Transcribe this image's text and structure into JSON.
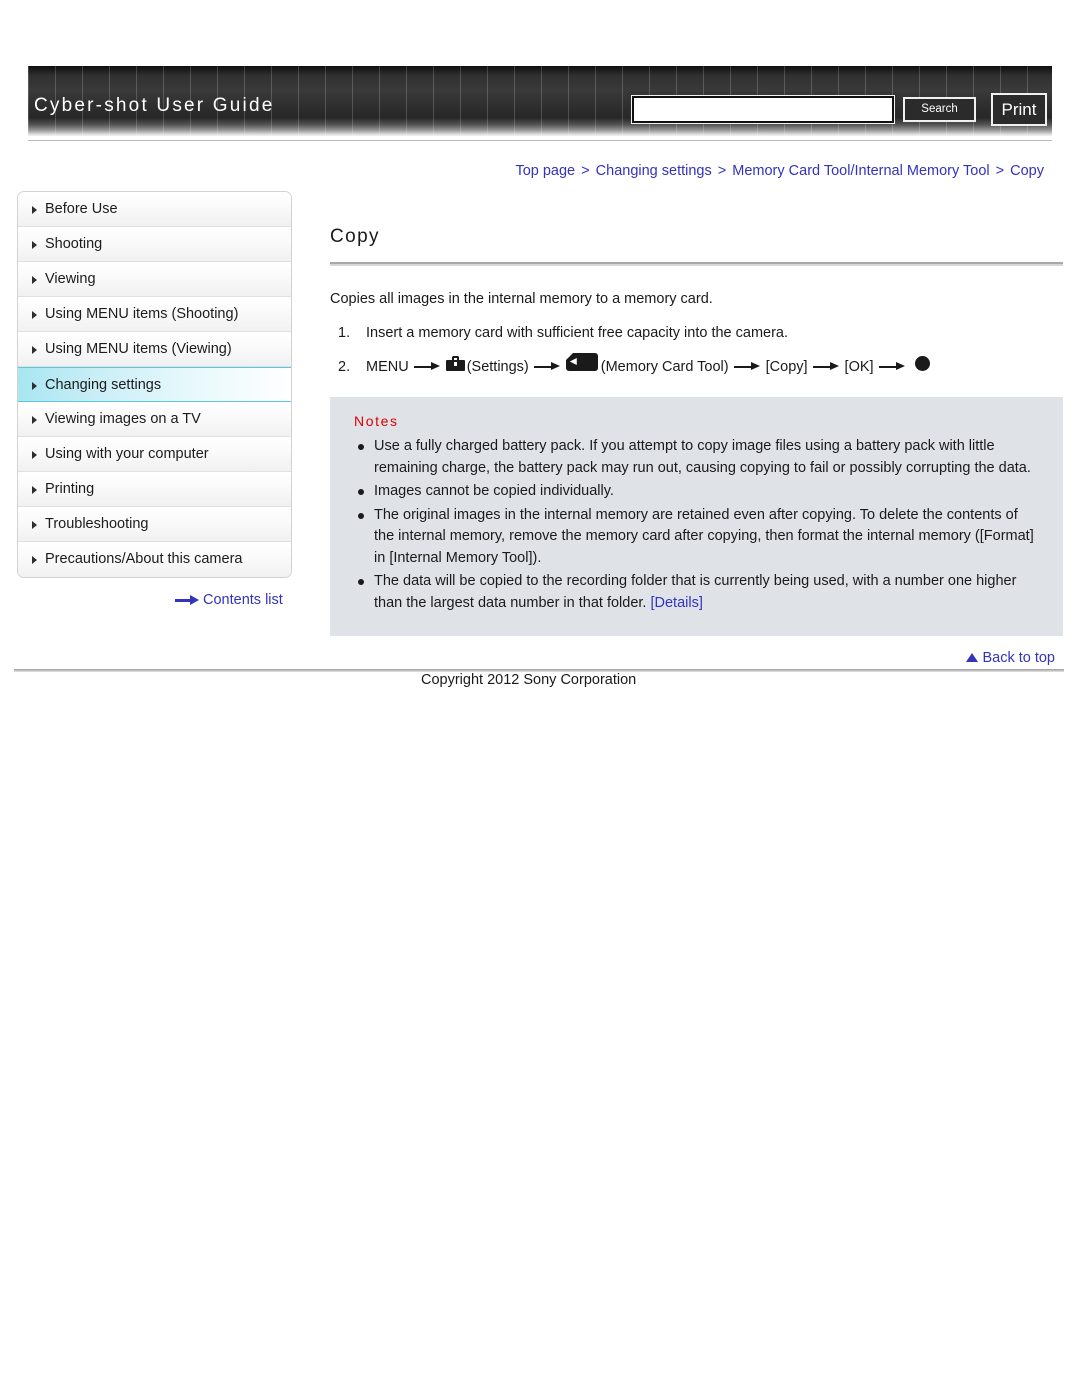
{
  "header": {
    "site_title": "Cyber-shot User Guide",
    "search_value": "",
    "search_placeholder": "",
    "search_button_label": "Search",
    "print_button_label": "Print"
  },
  "breadcrumb": {
    "items": [
      "Top page",
      "Changing settings",
      "Memory Card Tool/Internal Memory Tool",
      "Copy"
    ],
    "separator": ">"
  },
  "sidebar": {
    "items": [
      {
        "label": "Before Use",
        "active": false
      },
      {
        "label": "Shooting",
        "active": false
      },
      {
        "label": "Viewing",
        "active": false
      },
      {
        "label": "Using MENU items (Shooting)",
        "active": false
      },
      {
        "label": "Using MENU items (Viewing)",
        "active": false
      },
      {
        "label": "Changing settings",
        "active": true
      },
      {
        "label": "Viewing images on a TV",
        "active": false
      },
      {
        "label": "Using with your computer",
        "active": false
      },
      {
        "label": "Printing",
        "active": false
      },
      {
        "label": "Troubleshooting",
        "active": false
      },
      {
        "label": "Precautions/About this camera",
        "active": false
      }
    ],
    "contents_link_label": "Contents list"
  },
  "main": {
    "page_title": "Copy",
    "intro": "Copies all images in the internal memory to a memory card.",
    "steps": [
      {
        "number": "1.",
        "text": "Insert a memory card with sufficient free capacity into the camera."
      },
      {
        "number": "2.",
        "menu_label": "MENU",
        "settings_label": "(Settings)",
        "memory_card_tool_label": "(Memory Card Tool)",
        "copy_label": "[Copy]",
        "ok_label": "[OK]"
      }
    ],
    "notes": {
      "heading": "Notes",
      "items": [
        "Use a fully charged battery pack. If you attempt to copy image files using a battery pack with little remaining charge, the battery pack may run out, causing copying to fail or possibly corrupting the data.",
        "Images cannot be copied individually.",
        "The original images in the internal memory are retained even after copying. To delete the contents of the internal memory, remove the memory card after copying, then format the internal memory ([Format] in [Internal Memory Tool]).",
        "The data will be copied to the recording folder that is currently being used, with a number one higher than the largest data number in that folder. "
      ],
      "details_link_label": "[Details]"
    }
  },
  "footer": {
    "back_to_top_label": "Back to top",
    "copyright": "Copyright 2012 Sony Corporation"
  },
  "colors": {
    "link": "#3333bb",
    "notes_heading": "#e00000",
    "notes_background": "#dfe3e8",
    "active_nav": "#a8e6f2"
  }
}
